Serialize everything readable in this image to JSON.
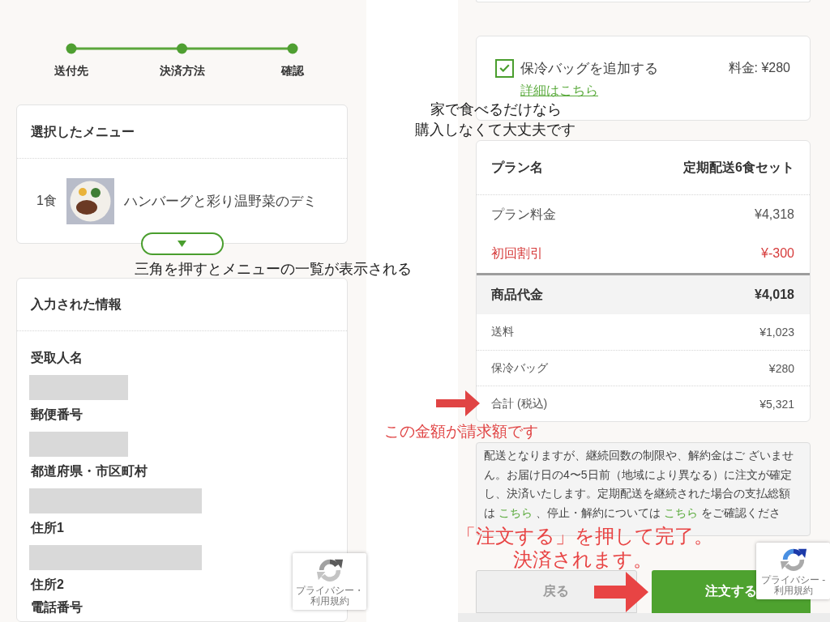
{
  "progress": {
    "steps": [
      {
        "label": "送付先"
      },
      {
        "label": "決済方法"
      },
      {
        "label": "確認"
      }
    ]
  },
  "menu_card": {
    "title": "選択したメニュー",
    "items": [
      {
        "quantity": "1食",
        "name": "ハンバーグと彩り温野菜のデミ"
      }
    ],
    "expanded": false
  },
  "info_card": {
    "title": "入力された情報",
    "fields": [
      {
        "label": "受取人名",
        "kind": "short"
      },
      {
        "label": "郵便番号",
        "kind": "short"
      },
      {
        "label": "都道府県・市区町村",
        "kind": "long"
      },
      {
        "label": "住所1",
        "kind": "long"
      },
      {
        "label": "住所2",
        "kind": "empty"
      },
      {
        "label": "電話番号",
        "kind": "empty"
      }
    ]
  },
  "bag_option": {
    "label": "保冷バッグを追加する",
    "checked": true,
    "price": "料金: ¥280",
    "link": "詳細はこちら"
  },
  "summary": {
    "rows": [
      {
        "label": "プラン名",
        "value": "定期配送6食セット",
        "kind": "header"
      },
      {
        "label": "プラン料金",
        "value": "¥4,318",
        "kind": "item"
      },
      {
        "label": "初回割引",
        "value": "¥-300",
        "kind": "discount"
      },
      {
        "label": "商品代金",
        "value": "¥4,018",
        "kind": "subtotal"
      },
      {
        "label": "送料",
        "value": "¥1,023",
        "kind": "fee"
      },
      {
        "label": "保冷バッグ",
        "value": "¥280",
        "kind": "fee"
      },
      {
        "label": "合計 (税込)",
        "value": "¥5,321",
        "kind": "fee"
      }
    ]
  },
  "notice": {
    "parts": [
      {
        "kind": "text",
        "text": "配送となりますが、継続回数の制限や、解約金はご ざいません。お届け日の4〜5日前（地域により異なる）に注文が確定し、決済いたします。定期配送を継続された場合の支払総額は "
      },
      {
        "kind": "link",
        "text": "こちら"
      },
      {
        "kind": "text",
        "text": " 、停止・解約については "
      },
      {
        "kind": "link",
        "text": "こちら"
      },
      {
        "kind": "text",
        "text": " をご確認くださ"
      }
    ]
  },
  "buttons": [
    {
      "label": "戻る",
      "kind": "secondary"
    },
    {
      "label": "注文する",
      "kind": "primary"
    }
  ],
  "captcha_badges": [
    {
      "caption": "プライバシー・利用規約",
      "disabled": true
    },
    {
      "caption": "プライバシー - 利用規約",
      "disabled": false
    }
  ],
  "annotations": [
    {
      "text": "三角を押すとメニューの一覧が表示される",
      "color": "#222222",
      "arrow": false
    },
    {
      "text": "家で食べるだけなら",
      "color": "#222222",
      "arrow": false
    },
    {
      "text": "購入しなくて大丈夫です",
      "color": "#222222",
      "arrow": false
    },
    {
      "text": "この金額が請求額です",
      "color": "#e04444",
      "arrow": true
    },
    {
      "text": "「注文する」を押して完了。",
      "color": "#e84444",
      "arrow": false
    },
    {
      "text": "決済されます。",
      "color": "#e84444",
      "arrow": true
    }
  ]
}
